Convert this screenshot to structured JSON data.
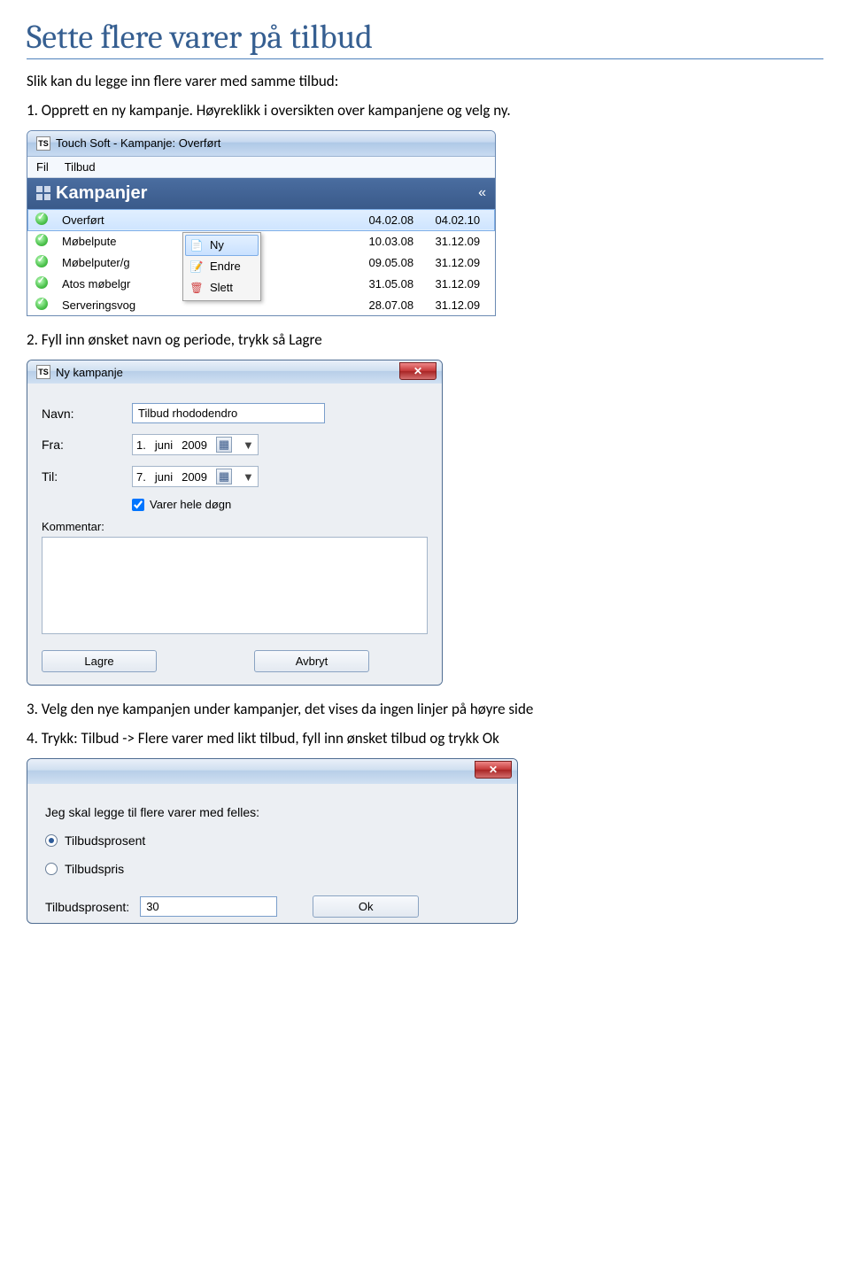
{
  "heading": "Sette flere varer på tilbud",
  "intro": "Slik kan du legge inn flere varer med samme tilbud:",
  "steps": {
    "s1": "1. Opprett en ny kampanje. Høyreklikk i oversikten over kampanjene og velg ny.",
    "s2": "2. Fyll inn ønsket navn og periode, trykk så Lagre",
    "s3": "3. Velg den nye kampanjen under kampanjer, det vises da ingen linjer på høyre side",
    "s4": "4. Trykk: Tilbud -> Flere varer med likt tilbud, fyll inn ønsket tilbud og trykk Ok"
  },
  "shot1": {
    "window_title": "Touch Soft - Kampanje: Overført",
    "menu": {
      "fil": "Fil",
      "tilbud": "Tilbud"
    },
    "panel_title": "Kampanjer",
    "collapse_glyph": "«",
    "rows": [
      {
        "name": "Overført",
        "from": "04.02.08",
        "to": "04.02.10",
        "selected": true
      },
      {
        "name": "Møbelpute",
        "from": "10.03.08",
        "to": "31.12.09",
        "selected": false
      },
      {
        "name": "Møbelputer/g",
        "from": "09.05.08",
        "to": "31.12.09",
        "selected": false
      },
      {
        "name": "Atos møbelgr",
        "from": "31.05.08",
        "to": "31.12.09",
        "selected": false
      },
      {
        "name": "Serveringsvog",
        "from": "28.07.08",
        "to": "31.12.09",
        "selected": false
      }
    ],
    "context": {
      "ny": "Ny",
      "endre": "Endre",
      "slett": "Slett"
    }
  },
  "shot2": {
    "title": "Ny kampanje",
    "labels": {
      "navn": "Navn:",
      "fra": "Fra:",
      "til": "Til:",
      "kommentar": "Kommentar:"
    },
    "navn_value": "Tilbud rhododendro",
    "date_from": {
      "d": "1.",
      "m": "juni",
      "y": "2009"
    },
    "date_to": {
      "d": "7.",
      "m": "juni",
      "y": "2009"
    },
    "varer_hele": "Varer hele døgn",
    "lagre": "Lagre",
    "avbryt": "Avbryt"
  },
  "shot3": {
    "prompt": "Jeg skal legge til flere varer med felles:",
    "opt1": "Tilbudsprosent",
    "opt2": "Tilbudspris",
    "field_label": "Tilbudsprosent:",
    "field_value": "30",
    "ok": "Ok"
  }
}
